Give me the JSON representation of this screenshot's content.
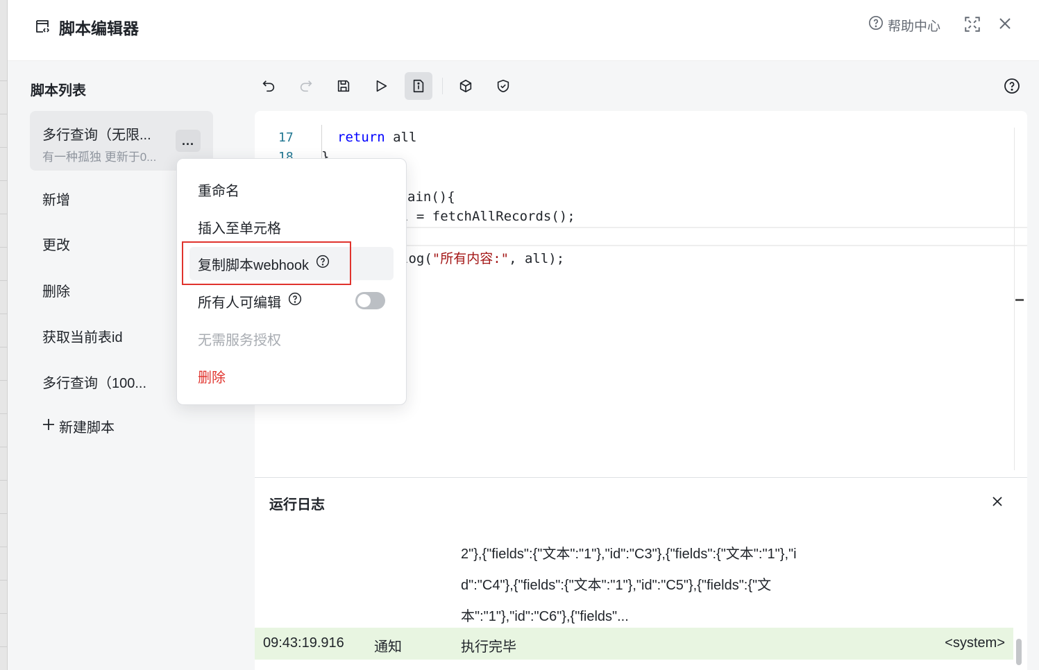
{
  "header": {
    "title": "脚本编辑器",
    "help_label": "帮助中心"
  },
  "sidebar": {
    "title": "脚本列表",
    "current_script": {
      "name": "多行查询（无限...",
      "meta": "有一种孤独 更新于0...",
      "more_label": "..."
    },
    "items": [
      {
        "label": "新增"
      },
      {
        "label": "更改"
      },
      {
        "label": "删除"
      },
      {
        "label": "获取当前表id"
      },
      {
        "label": "多行查询（100..."
      }
    ],
    "new_script_label": "新建脚本"
  },
  "editor": {
    "lines": [
      {
        "number": "17",
        "keyword": "return",
        "rest": " all"
      },
      {
        "number": "18",
        "text": "}"
      }
    ],
    "visible_code": {
      "main_decl": "ain(){",
      "fetch_call": "l = fetchAllRecords();",
      "log_pre": "log(",
      "log_str": "\"所有内容:\"",
      "log_post": ", all);"
    }
  },
  "log": {
    "title": "运行日志",
    "output_lines": [
      "2\"},{\"fields\":{\"文本\":\"1\"},\"id\":\"C3\"},{\"fields\":{\"文本\":\"1\"},\"i",
      "d\":\"C4\"},{\"fields\":{\"文本\":\"1\"},\"id\":\"C5\"},{\"fields\":{\"文",
      "本\":\"1\"},\"id\":\"C6\"},{\"fields\"..."
    ],
    "entry": {
      "time": "09:43:19.916",
      "level": "通知",
      "message": "执行完毕",
      "source": "<system>"
    }
  },
  "context_menu": {
    "items": [
      {
        "label": "重命名"
      },
      {
        "label": "插入至单元格"
      },
      {
        "label": "复制脚本webhook"
      },
      {
        "label": "所有人可编辑"
      },
      {
        "label": "无需服务授权"
      },
      {
        "label": "删除"
      }
    ],
    "everyone_edit_enabled": false
  },
  "colors": {
    "accent_red": "#e0332d",
    "success_bg": "#e8f5e1",
    "keyword": "#0000ff",
    "string": "#a31515",
    "line_number": "#237893"
  }
}
